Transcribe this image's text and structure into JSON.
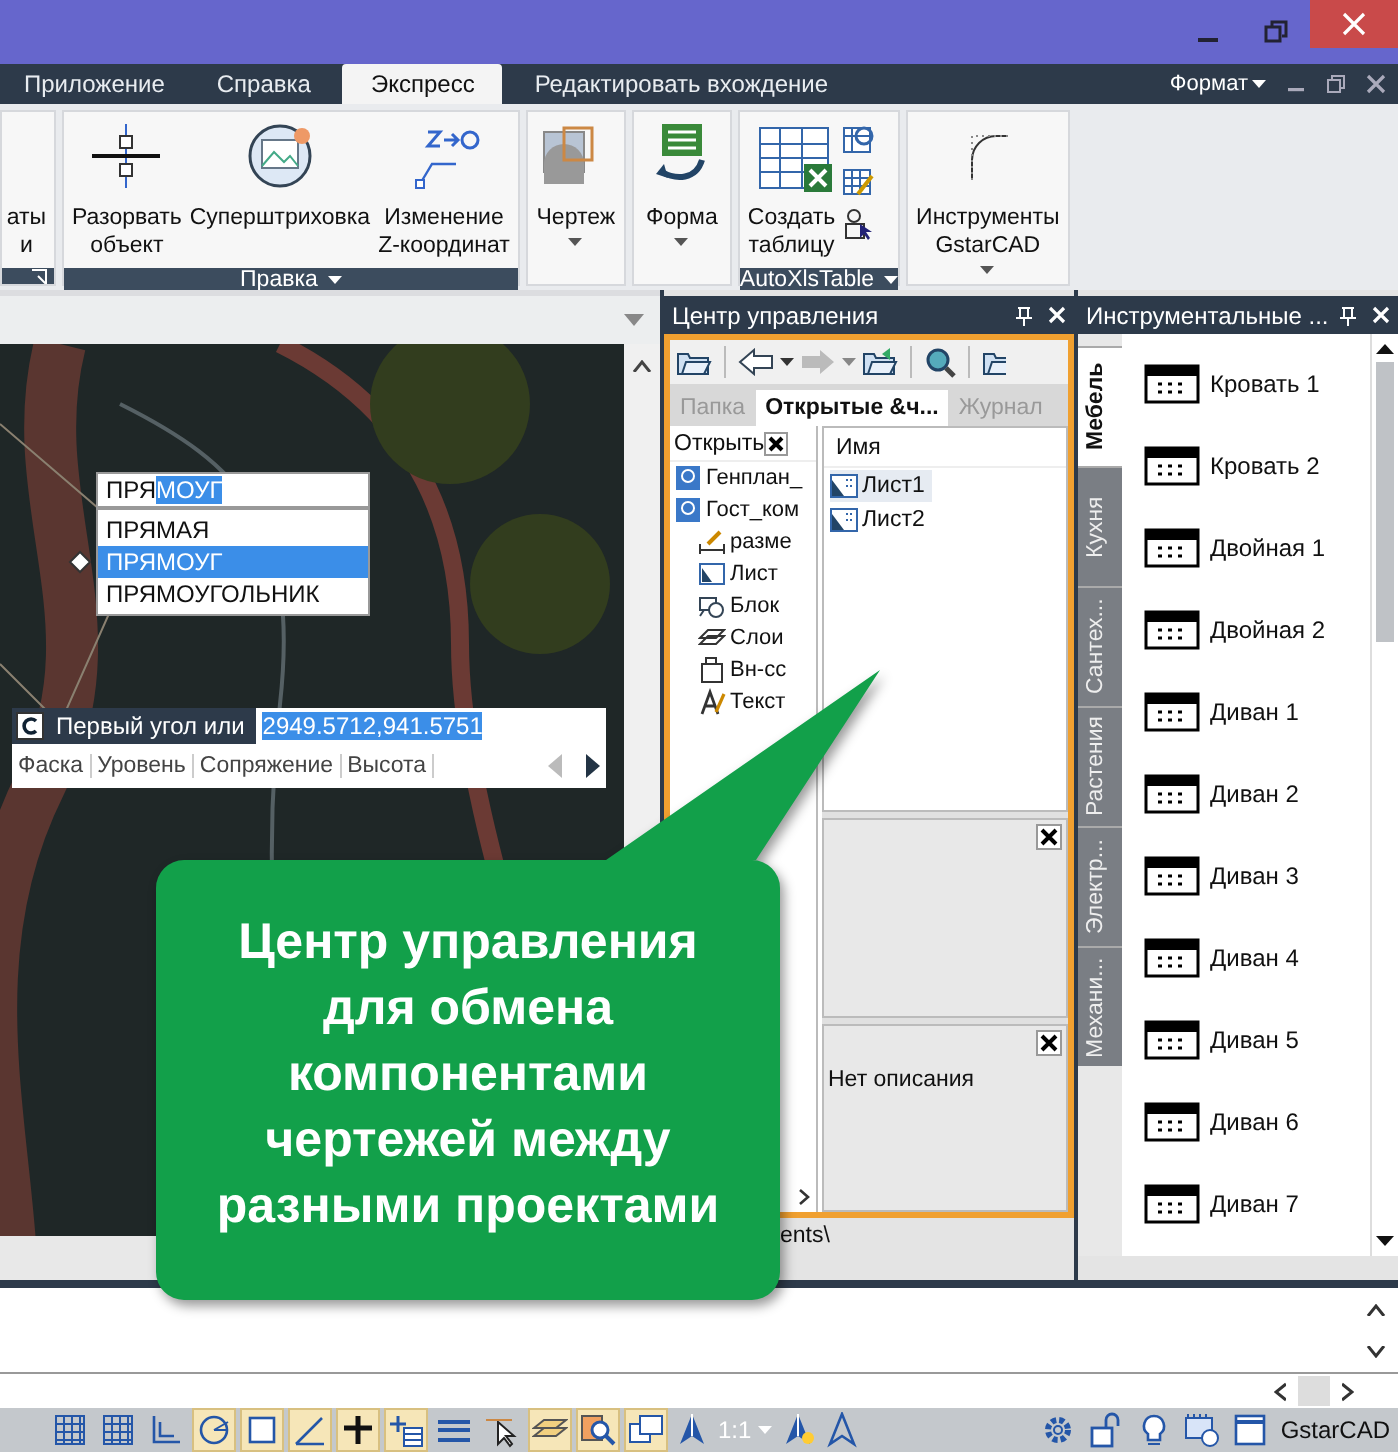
{
  "ribbon_tabs": [
    {
      "label": "Приложение",
      "selected": false
    },
    {
      "label": "Справка",
      "selected": false
    },
    {
      "label": "Экспресс",
      "selected": true
    },
    {
      "label": "Редактировать вхождение",
      "selected": false
    }
  ],
  "ribbon_menu": {
    "label": "Формат"
  },
  "ribbon_panels": [
    {
      "buttons": [
        {
          "kind": "none",
          "lines": [
            "аты",
            "и"
          ]
        }
      ],
      "launcher": true
    },
    {
      "title": "Правка",
      "buttons": [
        {
          "kind": "break",
          "lines": [
            "Разорвать",
            "объект"
          ]
        },
        {
          "kind": "hatch",
          "lines": [
            "Суперштриховка"
          ]
        },
        {
          "kind": "z",
          "lines": [
            "Изменение",
            "Z-координат"
          ]
        }
      ]
    },
    {
      "buttons": [
        {
          "kind": "sheet",
          "lines": [
            "Чертеж"
          ],
          "dropdown": true
        }
      ]
    },
    {
      "buttons": [
        {
          "kind": "form",
          "lines": [
            "Форма"
          ],
          "dropdown": true
        }
      ]
    },
    {
      "title": "AutoXlsTable",
      "buttons": [
        {
          "kind": "table",
          "lines": [
            "Создать",
            "таблицу"
          ]
        }
      ],
      "small_tools": [
        {
          "kind": "table-refresh"
        },
        {
          "kind": "table-edit"
        },
        {
          "kind": "select"
        }
      ]
    },
    {
      "buttons": [
        {
          "kind": "arc",
          "lines": [
            "Инструменты",
            "GstarCAD"
          ],
          "dropdown": true
        }
      ]
    }
  ],
  "canvas": {
    "autocomplete": {
      "typed": "ПРЯ",
      "completion": "МОУГ",
      "options": [
        {
          "label": "ПРЯМАЯ",
          "selected": false
        },
        {
          "label": "ПРЯМОУГ",
          "selected": true
        },
        {
          "label": "ПРЯМОУГОЛЬНИК",
          "selected": false
        }
      ]
    },
    "command_line": {
      "prompt": "Первый угол или",
      "value": "2949.5712,941.5751",
      "options": [
        "Фаска",
        "Уровень",
        "Сопряжение",
        "Высота"
      ]
    }
  },
  "control_center": {
    "title": "Центр управления",
    "tabs": [
      {
        "label": "Папка",
        "selected": false
      },
      {
        "label": "Открытые &ч...",
        "selected": true
      },
      {
        "label": "Журнал",
        "selected": false
      }
    ],
    "tree": {
      "header": "Открыть",
      "items": [
        {
          "label": "Генплан_",
          "kind": "drawing"
        },
        {
          "label": "Гост_ком",
          "kind": "drawing",
          "children": [
            {
              "label": "разме",
              "kind": "dimension"
            },
            {
              "label": "Лист",
              "kind": "sheet"
            },
            {
              "label": "Блок",
              "kind": "block"
            },
            {
              "label": "Слои",
              "kind": "layers"
            },
            {
              "label": "Вн-сс",
              "kind": "xref"
            },
            {
              "label": "Текст",
              "kind": "text"
            }
          ]
        }
      ]
    },
    "list": {
      "column": "Имя",
      "rows": [
        {
          "label": "Лист1",
          "selected": true
        },
        {
          "label": "Лист2",
          "selected": false
        }
      ]
    },
    "description": "Нет описания",
    "path": "ents\\"
  },
  "tool_palette": {
    "title": "Инструментальные ...",
    "tabs": [
      {
        "label": "Мебель",
        "selected": true
      },
      {
        "label": "Кухня",
        "selected": false
      },
      {
        "label": "Сантех...",
        "selected": false
      },
      {
        "label": "Растения",
        "selected": false
      },
      {
        "label": "Электр...",
        "selected": false
      },
      {
        "label": "Механи...",
        "selected": false
      }
    ],
    "items": [
      {
        "label": "Кровать 1"
      },
      {
        "label": "Кровать 2"
      },
      {
        "label": "Двойная 1"
      },
      {
        "label": "Двойная 2"
      },
      {
        "label": "Диван 1"
      },
      {
        "label": "Диван 2"
      },
      {
        "label": "Диван 3"
      },
      {
        "label": "Диван 4"
      },
      {
        "label": "Диван 5"
      },
      {
        "label": "Диван 6"
      },
      {
        "label": "Диван 7"
      }
    ]
  },
  "callout": {
    "text": "Центр управления для обмена компонентами чертежей между разными проектами"
  },
  "status_bar": {
    "toggles": [
      {
        "kind": "grid",
        "on": false
      },
      {
        "kind": "grid",
        "on": false
      },
      {
        "kind": "ortho",
        "on": false
      },
      {
        "kind": "polar",
        "on": true
      },
      {
        "kind": "rect",
        "on": true
      },
      {
        "kind": "angle",
        "on": true
      },
      {
        "kind": "cross",
        "on": true
      },
      {
        "kind": "table",
        "on": true
      },
      {
        "kind": "lines",
        "on": false
      },
      {
        "kind": "cursor",
        "on": false
      },
      {
        "kind": "layers",
        "on": true
      },
      {
        "kind": "zoom",
        "on": true
      },
      {
        "kind": "windows",
        "on": true
      }
    ],
    "scale": "1:1",
    "app": "GstarCAD"
  }
}
